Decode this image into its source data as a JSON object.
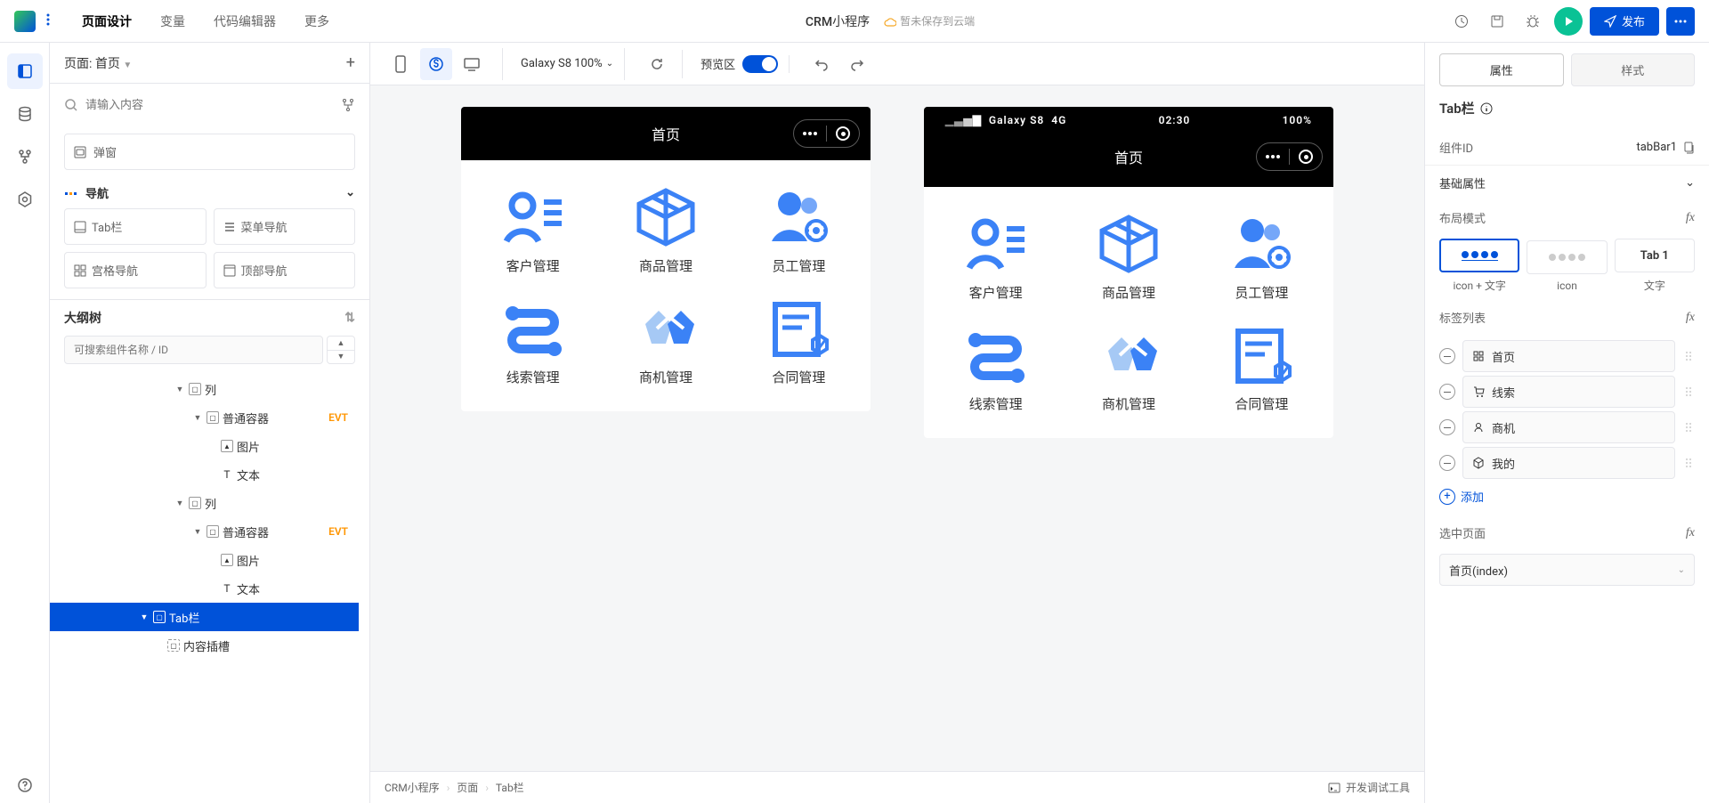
{
  "topbar": {
    "tabs": [
      "页面设计",
      "变量",
      "代码编辑器",
      "更多"
    ],
    "appTitle": "CRM小程序",
    "cloudStatus": "暂未保存到云端",
    "publish": "发布"
  },
  "leftPanel": {
    "pageLabel": "页面:",
    "pageName": "首页",
    "searchPlaceholder": "请输入内容",
    "popup": "弹窗",
    "navHeader": "导航",
    "navItems": [
      "Tab栏",
      "菜单导航",
      "宫格导航",
      "顶部导航"
    ],
    "outlineHeader": "大纲树",
    "outlineSearchPlaceholder": "可搜索组件名称 / ID",
    "tree": {
      "col1": "列",
      "container1": "普通容器",
      "evt": "EVT",
      "img": "图片",
      "text": "文本",
      "col2": "列",
      "container2": "普通容器",
      "tabbar": "Tab栏",
      "slot": "内容插槽"
    }
  },
  "canvasToolbar": {
    "device": "Galaxy S8 100%",
    "preview": "预览区"
  },
  "phone": {
    "title": "首页",
    "statusDevice": "Galaxy S8",
    "statusNet": "4G",
    "statusTime": "02:30",
    "statusBatt": "100%",
    "gridLabels": [
      "客户管理",
      "商品管理",
      "员工管理",
      "线索管理",
      "商机管理",
      "合同管理"
    ]
  },
  "breadcrumb": {
    "items": [
      "CRM小程序",
      "页面",
      "Tab栏"
    ],
    "devtool": "开发调试工具"
  },
  "rightPanel": {
    "tabs": [
      "属性",
      "样式"
    ],
    "componentTitle": "Tab栏",
    "componentIdLabel": "组件ID",
    "componentId": "tabBar1",
    "basicProps": "基础属性",
    "layoutMode": "布局模式",
    "layoutModes": [
      "icon + 文字",
      "icon",
      "文字"
    ],
    "layoutTab1": "Tab 1",
    "tagListLabel": "标签列表",
    "tags": [
      "首页",
      "线索",
      "商机",
      "我的"
    ],
    "addTag": "添加",
    "selectedPageLabel": "选中页面",
    "selectedPage": "首页(index)"
  }
}
